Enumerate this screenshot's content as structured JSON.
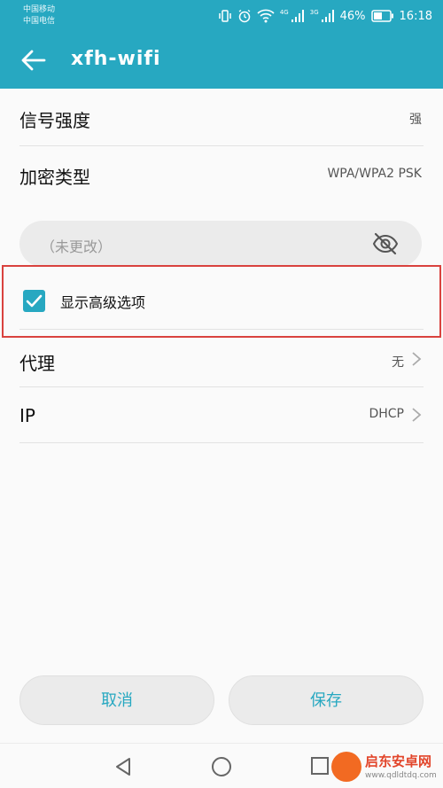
{
  "status_bar": {
    "carrier_1": "中国移动",
    "carrier_2": "中国电信",
    "net_tag_1": "4G",
    "net_tag_2": "3G",
    "battery": "46%",
    "time": "16:18"
  },
  "app_bar": {
    "title": "xfh-wifi",
    "back_icon": "arrow-left-icon"
  },
  "info": {
    "signal_label": "信号强度",
    "signal_value": "强",
    "security_label": "加密类型",
    "security_value": "WPA/WPA2 PSK"
  },
  "password": {
    "placeholder": "（未更改）",
    "toggle_icon": "eye-off-icon"
  },
  "advanced": {
    "label": "显示高级选项",
    "checked": true
  },
  "proxy": {
    "label": "代理",
    "value": "无"
  },
  "ip": {
    "label": "IP",
    "value": "DHCP"
  },
  "buttons": {
    "cancel": "取消",
    "save": "保存"
  },
  "nav": {
    "back_icon": "triangle-back-icon",
    "home_icon": "circle-home-icon",
    "recent_icon": "square-recent-icon"
  },
  "watermark": {
    "name": "启东安卓网",
    "url": "www.qdldtdq.com"
  },
  "colors": {
    "accent": "#27a8c1",
    "highlight_border": "#d9423e",
    "field_bg": "#ebebeb"
  }
}
